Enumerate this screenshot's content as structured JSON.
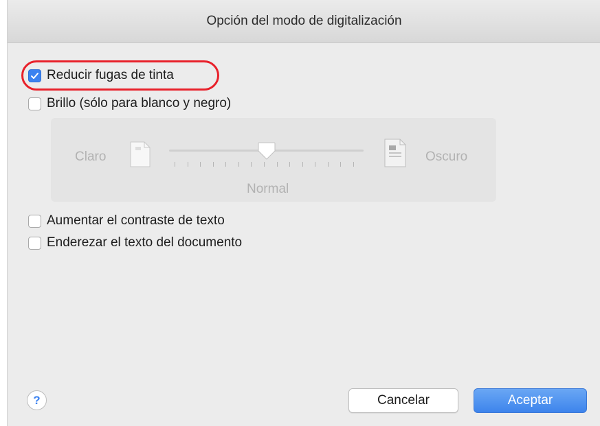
{
  "dialog": {
    "title": "Opción del modo de digitalización"
  },
  "options": {
    "reduce_ink_bleed": {
      "label": "Reducir fugas de tinta",
      "checked": true
    },
    "brightness": {
      "label": "Brillo (sólo para blanco y negro)",
      "checked": false
    },
    "increase_contrast": {
      "label": "Aumentar el contraste de texto",
      "checked": false
    },
    "straighten_text": {
      "label": "Enderezar el texto del documento",
      "checked": false
    }
  },
  "brightness_slider": {
    "left_label": "Claro",
    "right_label": "Oscuro",
    "value_label": "Normal",
    "tick_count": 15,
    "position": 0.5,
    "enabled": false,
    "left_icon": "light-document-icon",
    "right_icon": "dark-document-icon"
  },
  "buttons": {
    "help": "?",
    "cancel": "Cancelar",
    "accept": "Aceptar"
  },
  "colors": {
    "accent": "#3b82f0",
    "highlight": "#e8202a"
  }
}
